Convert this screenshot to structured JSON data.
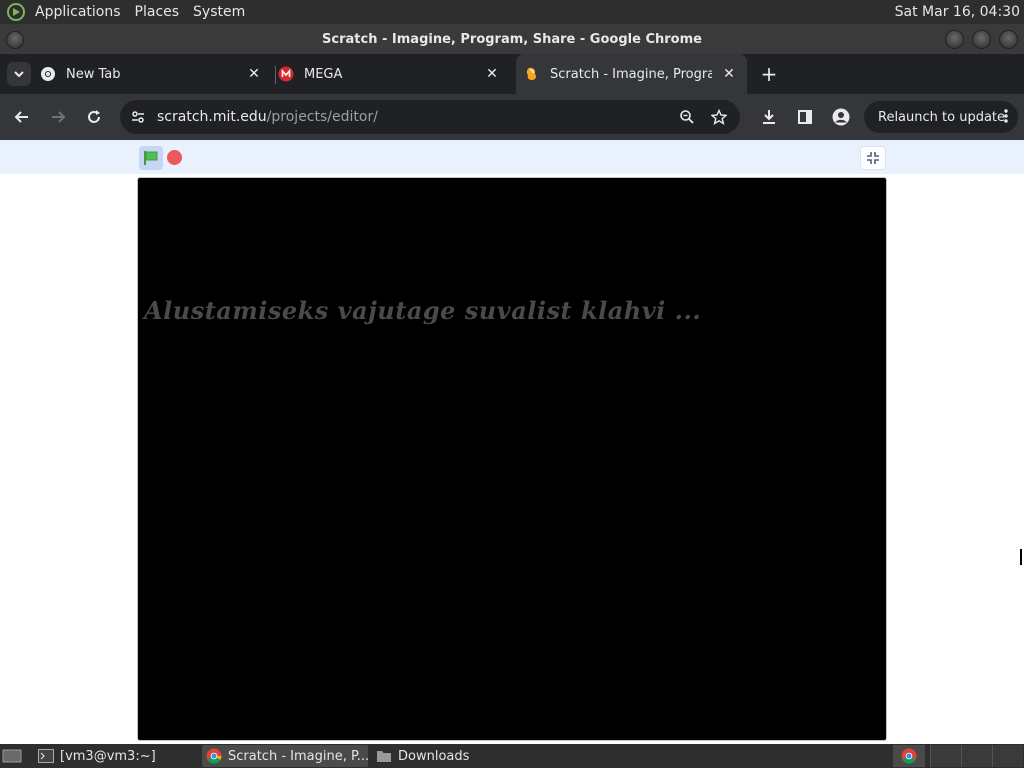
{
  "system_panel": {
    "menus": [
      "Applications",
      "Places",
      "System"
    ],
    "clock": "Sat Mar 16, 04:30"
  },
  "window": {
    "title": "Scratch - Imagine, Program, Share - Google Chrome"
  },
  "tabs": [
    {
      "title": "New Tab",
      "icon": "chrome-icon",
      "active": false
    },
    {
      "title": "MEGA",
      "icon": "mega-icon",
      "active": false
    },
    {
      "title": "Scratch - Imagine, Program, Share",
      "icon": "scratch-icon",
      "active": true
    }
  ],
  "toolbar": {
    "url_host": "scratch.mit.edu",
    "url_path": "/projects/editor/",
    "relaunch_label": "Relaunch to update"
  },
  "stage": {
    "message": "Alustamiseks vajutage suvalist klahvi ..."
  },
  "taskbar": {
    "items": [
      {
        "label": "[vm3@vm3:~]",
        "icon": "terminal-icon"
      },
      {
        "label": "Scratch - Imagine, P...",
        "icon": "chrome-icon"
      },
      {
        "label": "Downloads",
        "icon": "folder-icon"
      }
    ]
  },
  "colors": {
    "panel": "#2e2e2e",
    "tabstrip": "#202124",
    "toolbar": "#35363a",
    "stage_header": "#e9f1fc",
    "stop": "#ec5959",
    "green_flag": "#4cbf56"
  }
}
